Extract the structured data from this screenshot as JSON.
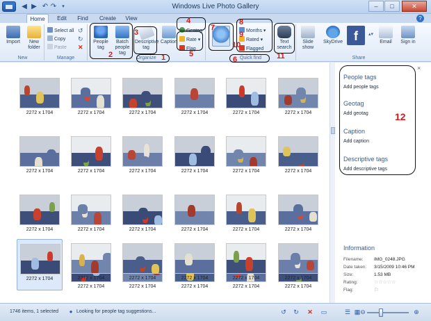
{
  "window": {
    "title": "Windows Live Photo Gallery",
    "controls": [
      "–",
      "□",
      "✕"
    ]
  },
  "tabs": [
    "Home",
    "Edit",
    "Find",
    "Create",
    "View"
  ],
  "ribbon": {
    "new_group": {
      "label": "New",
      "import": "Import",
      "new_folder": "New folder"
    },
    "manage_group": {
      "label": "Manage",
      "select_all": "Select all",
      "copy": "Copy",
      "paste": "Paste"
    },
    "organize_group": {
      "label": "Organize",
      "people_tag": "People tag",
      "batch_people_tag": "Batch people tag",
      "descriptive_tag": "Descriptive tag",
      "caption": "Caption",
      "geotag": "Geotag",
      "rate": "Rate",
      "flag": "Flag"
    },
    "quick_find_group": {
      "label": "Quick find",
      "months": "Months",
      "rated": "Rated",
      "flagged": "Flagged",
      "text_search": "Text search"
    },
    "share_group": {
      "label": "Share",
      "slide_show": "Slide show",
      "skydrive": "SkyDrive",
      "email": "Email",
      "sign_in": "Sign in"
    }
  },
  "annotations": [
    "1",
    "2",
    "3",
    "4",
    "5",
    "6",
    "7",
    "8",
    "9",
    "10",
    "11",
    "12"
  ],
  "thumbnails": {
    "dimensions": "2272 x 1704",
    "rows": 5,
    "cols": 6,
    "selected_index": 24
  },
  "info_pane": {
    "close": "×",
    "people_tags_title": "People tags",
    "people_tags_add": "Add people tags",
    "geotag_title": "Geotag",
    "geotag_add": "Add geotag",
    "caption_title": "Caption",
    "caption_add": "Add caption",
    "descriptive_title": "Descriptive tags",
    "descriptive_add": "Add descriptive tags",
    "information_title": "Information",
    "filename_label": "Filename:",
    "filename_value": "IMG_0248.JPG",
    "date_label": "Date taken:",
    "date_value": "3/15/2009  10:46 PM",
    "size_label": "Size:",
    "size_value": "1.53 MB",
    "rating_label": "Rating:",
    "rating_value": 0,
    "rating_max": 5,
    "flag_label": "Flag:"
  },
  "status": {
    "count": "1746 items, 1 selected",
    "message": "Looking for people tag suggestions..."
  },
  "zoom_level": 0.3
}
